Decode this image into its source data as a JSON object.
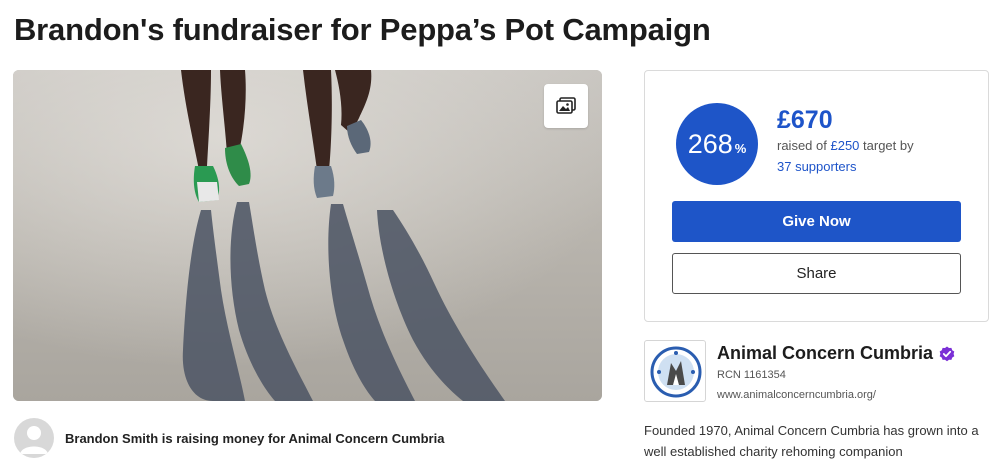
{
  "page": {
    "title": "Brandon's fundraiser for Peppa’s Pot Campaign"
  },
  "hero": {
    "image_alt": "Runners' legs and long shadows on a road",
    "gallery_icon": "image-gallery-icon"
  },
  "organiser": {
    "avatar_icon": "user-avatar-icon",
    "text": "Brandon Smith is raising money for Animal Concern Cumbria"
  },
  "donation": {
    "progress_value": "268",
    "progress_unit": "%",
    "progress_fraction": 2.68,
    "raised": "£670",
    "raised_prefix": "raised of ",
    "target": "£250",
    "raised_suffix": " target by",
    "supporters": "37 supporters",
    "give_label": "Give Now",
    "share_label": "Share"
  },
  "charity": {
    "name": "Animal Concern Cumbria",
    "verified_icon": "verified-badge-icon",
    "rcn": "RCN 1161354",
    "url": "www.animalconcerncumbria.org/",
    "description": "Founded 1970, Animal Concern Cumbria has grown into a well established charity rehoming companion"
  },
  "colors": {
    "brand_blue": "#1e55c8",
    "verified_purple": "#7b2fd6"
  }
}
